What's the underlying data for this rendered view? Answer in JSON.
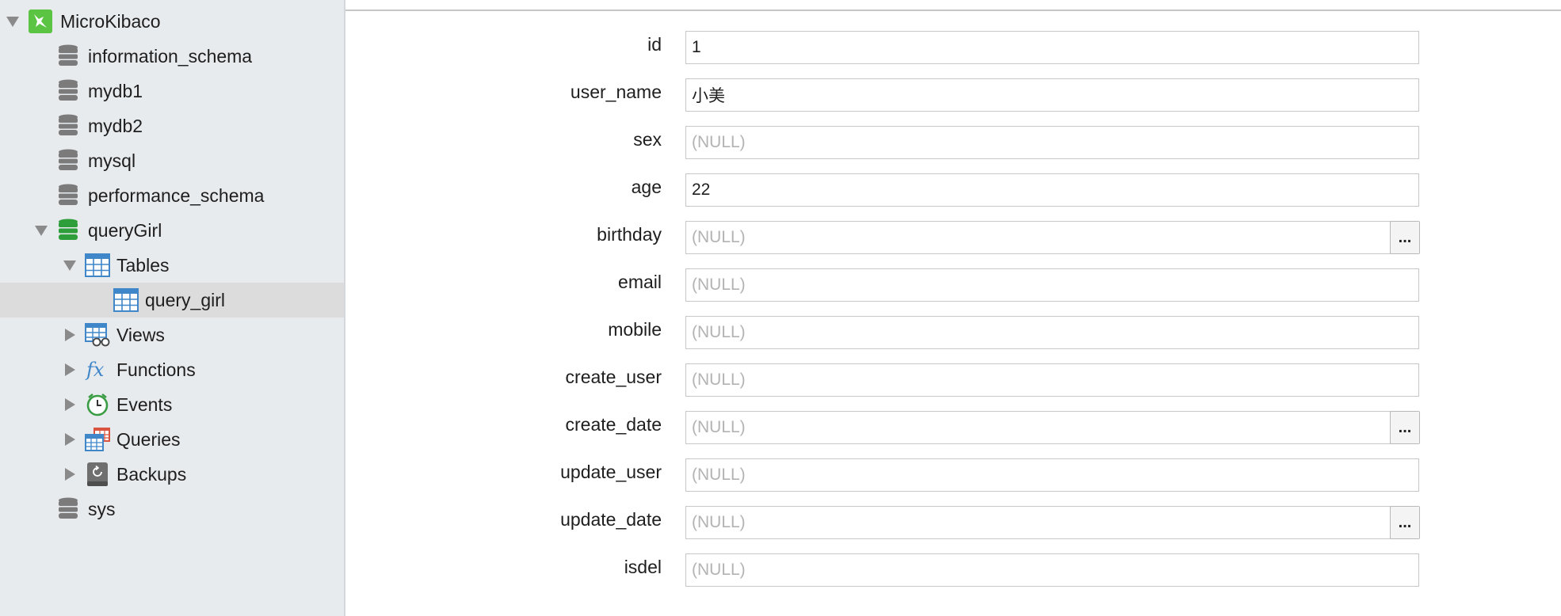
{
  "sidebar": {
    "connection": {
      "label": "MicroKibaco",
      "icon": "connection-icon"
    },
    "databases": [
      {
        "label": "information_schema",
        "icon": "database-icon"
      },
      {
        "label": "mydb1",
        "icon": "database-icon"
      },
      {
        "label": "mydb2",
        "icon": "database-icon"
      },
      {
        "label": "mysql",
        "icon": "database-icon"
      },
      {
        "label": "performance_schema",
        "icon": "database-icon"
      },
      {
        "label": "queryGirl",
        "icon": "database-open-icon"
      }
    ],
    "groups": {
      "tables": {
        "label": "Tables"
      },
      "table_item": {
        "label": "query_girl"
      },
      "views": {
        "label": "Views"
      },
      "functions": {
        "label": "Functions"
      },
      "events": {
        "label": "Events"
      },
      "queries": {
        "label": "Queries"
      },
      "backups": {
        "label": "Backups"
      }
    },
    "sys": {
      "label": "sys"
    }
  },
  "form": {
    "null_placeholder": "(NULL)",
    "button_label": "...",
    "fields": [
      {
        "label": "id",
        "value": "1"
      },
      {
        "label": "user_name",
        "value": "小美"
      },
      {
        "label": "sex",
        "value": ""
      },
      {
        "label": "age",
        "value": "22"
      },
      {
        "label": "birthday",
        "value": ""
      },
      {
        "label": "email",
        "value": ""
      },
      {
        "label": "mobile",
        "value": ""
      },
      {
        "label": "create_user",
        "value": ""
      },
      {
        "label": "create_date",
        "value": ""
      },
      {
        "label": "update_user",
        "value": ""
      },
      {
        "label": "update_date",
        "value": ""
      },
      {
        "label": "isdel",
        "value": ""
      }
    ]
  }
}
